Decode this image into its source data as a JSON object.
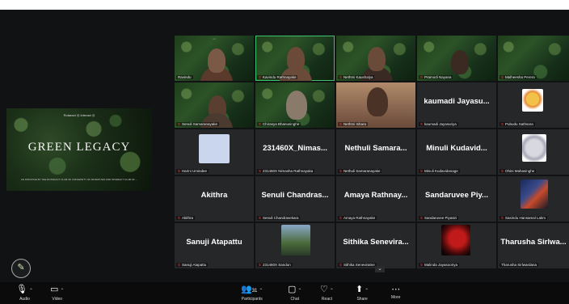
{
  "presentation": {
    "logos": "Rotaract ◎  Interact ◎",
    "title": "GREEN LEGACY",
    "subtitle": "AN INITIATIVE BY THE ROTARACT CLUB OF UNIVERSITY OF MORATUWA AND INTERACT CLUB OF ..."
  },
  "gallery": {
    "row1": [
      {
        "label": "Ravindu",
        "type": "video"
      },
      {
        "label": "Kavindu Rathnayake",
        "type": "video",
        "active": true
      },
      {
        "label": "Nethmi Kaushalya",
        "type": "video"
      },
      {
        "label": "Pramodi Nayana",
        "type": "video"
      },
      {
        "label": "Malheesha Perera",
        "type": "video"
      }
    ],
    "row2": [
      {
        "label": "Senuli Samaranayake",
        "type": "video"
      },
      {
        "label": "Chirasya Bhanusinghe",
        "type": "video"
      },
      {
        "label": "Nethmi Ishara",
        "type": "video"
      },
      {
        "big": "kaumadi Jayasu...",
        "label": "kaumadi Jayasuriya"
      },
      {
        "label": "Pubudu Sathsara",
        "type": "avatar"
      }
    ],
    "row3": [
      {
        "label": "Harini Umindee",
        "type": "avatar"
      },
      {
        "big": "231460X_Nimas...",
        "label": "231460X Nimasha Rathnayaka"
      },
      {
        "big": "Nethuli Samara...",
        "label": "Nethuli Samaranayake"
      },
      {
        "big": "Minuli Kudavid...",
        "label": "Minuli Kudavidanage"
      },
      {
        "label": "Ohini Mahasinghe",
        "type": "avatar"
      }
    ],
    "row4": [
      {
        "big": "Akithra",
        "label": "Akithra"
      },
      {
        "big": "Senuli Chandras...",
        "label": "Senuli Chandrasekara"
      },
      {
        "big": "Amaya Rathnay...",
        "label": "Amaya Rathnayake"
      },
      {
        "big": "Sandaruvee Piy...",
        "label": "Sandaruvee Piyasiri"
      },
      {
        "label": "Sasindu Hansamal Lakm",
        "type": "avatar"
      }
    ],
    "row5": [
      {
        "big": "Sanuji Atapattu",
        "label": "Sanuji Atapattu"
      },
      {
        "label": "231460X Sandun",
        "type": "avatar"
      },
      {
        "big": "Sithika Senevira...",
        "label": "Sithika Seneviratne"
      },
      {
        "label": "Malinda Jayasooriya",
        "type": "avatar"
      },
      {
        "big": "Tharusha Sirlwa...",
        "label": "Tharusha Sirlwardana"
      }
    ]
  },
  "toolbar": {
    "audio": "Audio",
    "video": "Video",
    "participants": "Participants",
    "participants_count": "31",
    "chat": "Chat",
    "react": "React",
    "share": "Share",
    "more": "More"
  },
  "icons": {
    "mic": "mic-icon",
    "camera": "camera-icon",
    "participants": "participants-icon",
    "chat": "chat-icon",
    "react": "heart-icon",
    "share": "share-screen-icon",
    "more": "more-icon",
    "annotate": "pencil-icon",
    "scroll": "chevron-down-icon"
  }
}
